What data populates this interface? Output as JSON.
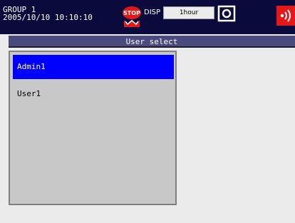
{
  "status": {
    "group": "GROUP 1",
    "datetime": "2005/10/10 10:10:10",
    "stop_icon_text": "STOP",
    "disp_label": "DISP",
    "display_interval": "1hour",
    "icons": [
      "stop-icon",
      "memory-media-icon",
      "alarm-icon"
    ],
    "colors": {
      "background": "#0a0a3c",
      "stop": "#e41818",
      "alarm": "#e41818"
    }
  },
  "dialog": {
    "title": "User select",
    "users": [
      "Admin1",
      "User1"
    ],
    "selected_index": 0,
    "colors": {
      "title_bar": "#4a4a7e",
      "selection": "#0000ff",
      "list_bg": "#c8c8c8"
    }
  }
}
